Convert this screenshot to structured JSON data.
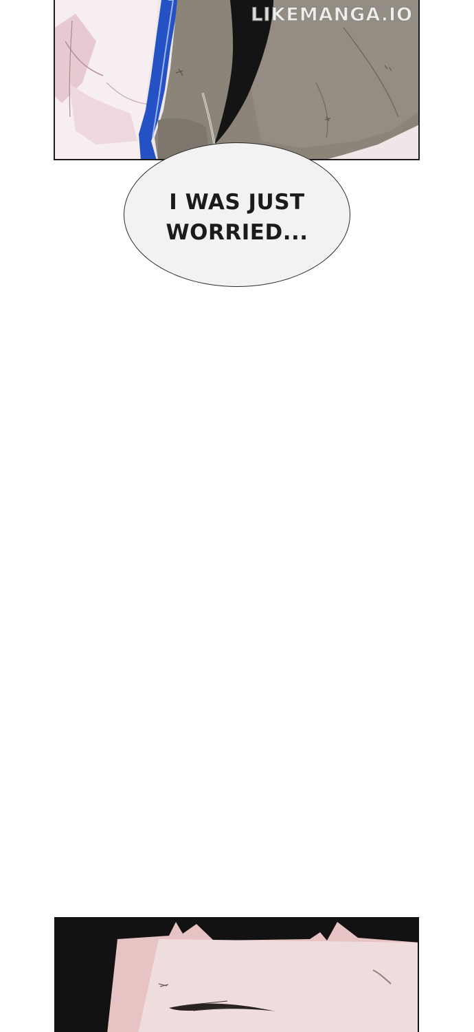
{
  "watermark": "LIKEMANGA.IO",
  "dialogue": {
    "line1": "I WAS JUST",
    "line2": "WORRIED..."
  },
  "colors": {
    "skin_pink": "#f3e3e6",
    "jacket_blue": "#2452c4",
    "coat_gray": "#8a8479",
    "hair_black": "#141414",
    "face_pink": "#e7c3c4",
    "bubble_fill": "#f2f2f2"
  }
}
